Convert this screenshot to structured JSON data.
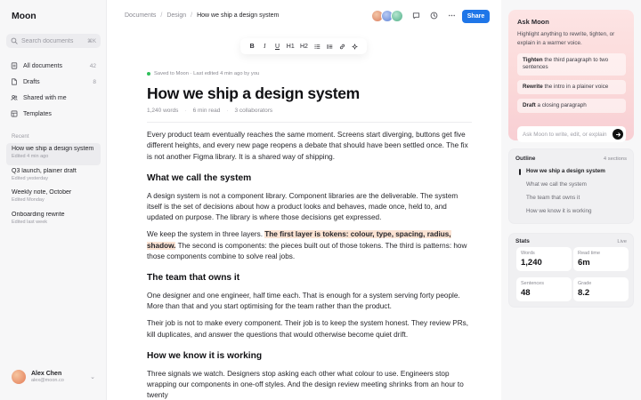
{
  "app": {
    "name": "Moon"
  },
  "sidebar": {
    "search": {
      "placeholder": "Search documents",
      "shortcut": "⌘K"
    },
    "nav": [
      {
        "label": "All documents",
        "count": "42",
        "icon": "document-icon"
      },
      {
        "label": "Drafts",
        "count": "8",
        "icon": "draft-icon"
      },
      {
        "label": "Shared with me",
        "count": "",
        "icon": "users-icon"
      },
      {
        "label": "Templates",
        "count": "",
        "icon": "template-icon"
      }
    ],
    "recent_label": "Recent",
    "recent": [
      {
        "title": "How we ship a design system",
        "sub": "Edited 4 min ago"
      },
      {
        "title": "Q3 launch, plainer draft",
        "sub": "Edited yesterday"
      },
      {
        "title": "Weekly note, October",
        "sub": "Edited Monday"
      },
      {
        "title": "Onboarding rewrite",
        "sub": "Edited last week"
      }
    ],
    "user": {
      "name": "Alex Chen",
      "email": "alex@moon.co",
      "more": "⌄"
    }
  },
  "topbar": {
    "breadcrumb": [
      "Documents",
      "Design",
      "How we ship a design system"
    ],
    "share_label": "Share",
    "collaborator_colors": [
      "#e39a7b",
      "#7d9be0",
      "#6fbfa0"
    ]
  },
  "formatting": {
    "bold": "B",
    "italic": "I",
    "underline": "U",
    "h1": "H1",
    "h2": "H2"
  },
  "document": {
    "saved": "Saved to Moon · Last edited 4 min ago by you",
    "title": "How we ship a design system",
    "meta": {
      "words": "1,240 words",
      "read": "6 min read",
      "collaborators": "3 collaborators"
    },
    "p1": "Every product team eventually reaches the same moment. Screens start diverging, buttons get five different heights, and every new page reopens a debate that should have been settled once. The fix is not another Figma library. It is a shared way of shipping.",
    "h2_1": "What we call the system",
    "p2": "A design system is not a component library. Component libraries are the deliverable. The system itself is the set of decisions about how a product looks and behaves, made once, held to, and updated on purpose. The library is where those decisions get expressed.",
    "p3_before": "We keep the system in three layers. ",
    "p3_highlight": "The first layer is tokens: colour, type, spacing, radius, shadow.",
    "p3_after": " The second is components: the pieces built out of those tokens. The third is patterns: how those components combine to solve real jobs.",
    "h2_2": "The team that owns it",
    "p4": "One designer and one engineer, half time each. That is enough for a system serving forty people. More than that and you start optimising for the team rather than the product.",
    "p5": "Their job is not to make every component. Their job is to keep the system honest. They review PRs, kill duplicates, and answer the questions that would otherwise become quiet drift.",
    "h2_3": "How we know it is working",
    "p6": "Three signals we watch. Designers stop asking each other what colour to use. Engineers stop wrapping our components in one-off styles. And the design review meeting shrinks from an hour to twenty"
  },
  "ask": {
    "title": "Ask Moon",
    "desc": "Highlight anything to rewrite, tighten, or explain in a warmer voice.",
    "suggestions": [
      {
        "verb": "Tighten",
        "rest": " the third paragraph to two sentences"
      },
      {
        "verb": "Rewrite",
        "rest": " the intro in a plainer voice"
      },
      {
        "verb": "Draft",
        "rest": " a closing paragraph"
      }
    ],
    "input_placeholder": "Ask Moon to write, edit, or explain"
  },
  "outline": {
    "title": "Outline",
    "count": "4 sections",
    "items": [
      "How we ship a design system",
      "What we call the system",
      "The team that owns it",
      "How we know it is working"
    ]
  },
  "stats": {
    "title": "Stats",
    "live": "Live",
    "cards": [
      {
        "label": "Words",
        "value": "1,240"
      },
      {
        "label": "Read time",
        "value": "6m"
      },
      {
        "label": "Sentences",
        "value": "48"
      },
      {
        "label": "Grade",
        "value": "8.2"
      }
    ]
  }
}
